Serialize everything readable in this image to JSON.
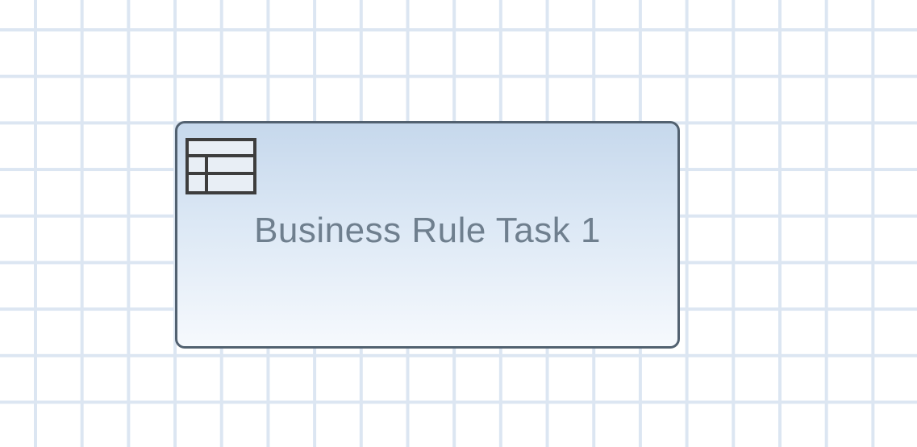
{
  "task": {
    "label": "Business Rule Task 1",
    "icon": "business-rule-table-icon"
  }
}
